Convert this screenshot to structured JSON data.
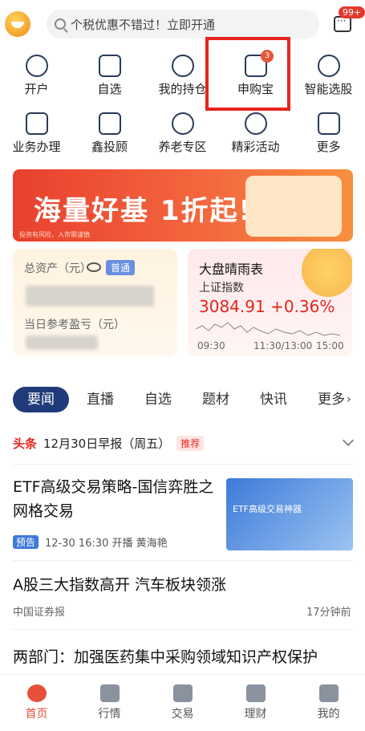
{
  "header": {
    "search_placeholder": "个税优惠不错过！立即开通",
    "message_badge": "99+"
  },
  "grid": {
    "row1": [
      {
        "label": "开户",
        "icon": "add-user-icon"
      },
      {
        "label": "自选",
        "icon": "chart-icon"
      },
      {
        "label": "我的持仓",
        "icon": "pie-icon"
      },
      {
        "label": "申购宝",
        "icon": "ipo-icon",
        "badge": "3"
      },
      {
        "label": "智能选股",
        "icon": "ai-chart-icon"
      }
    ],
    "row2": [
      {
        "label": "业务办理",
        "icon": "doc-icon"
      },
      {
        "label": "鑫投顾",
        "icon": "tie-icon"
      },
      {
        "label": "养老专区",
        "icon": "heart-icon"
      },
      {
        "label": "精彩活动",
        "icon": "star-icon"
      },
      {
        "label": "更多",
        "icon": "grid-icon"
      }
    ]
  },
  "banner": {
    "title": "海量好基 1折起!",
    "small_text": "投资有风险，入市需谨慎"
  },
  "assets_card": {
    "total_label": "总资产（元）",
    "tag": "普通",
    "pnl_label": "当日参考盈亏（元）"
  },
  "market_card": {
    "title": "大盘晴雨表",
    "index_name": "上证指数",
    "value": "3084.91 +0.36%",
    "times": [
      "09:30",
      "11:30/13:00",
      "15:00"
    ]
  },
  "tabs": [
    "要闻",
    "直播",
    "自选",
    "题材",
    "快讯",
    "更多"
  ],
  "headline": {
    "tag": "头条",
    "text": "12月30日早报（周五）",
    "badge": "推荐"
  },
  "news": [
    {
      "title": "ETF高级交易策略-国信弈胜之网格交易",
      "tag": "预告",
      "meta": "12-30 16:30 开播 黄海艳",
      "image_text": "ETF高级交易神器"
    },
    {
      "title": "A股三大指数高开 汽车板块领涨",
      "source": "中国证券报",
      "time": "17分钟前"
    },
    {
      "title": "两部门：加强医药集中采购领域知识产权保护"
    }
  ],
  "bottom_nav": [
    "首页",
    "行情",
    "交易",
    "理财",
    "我的"
  ],
  "colors": {
    "brand_red": "#e5251c",
    "navy": "#1f3b7a"
  }
}
